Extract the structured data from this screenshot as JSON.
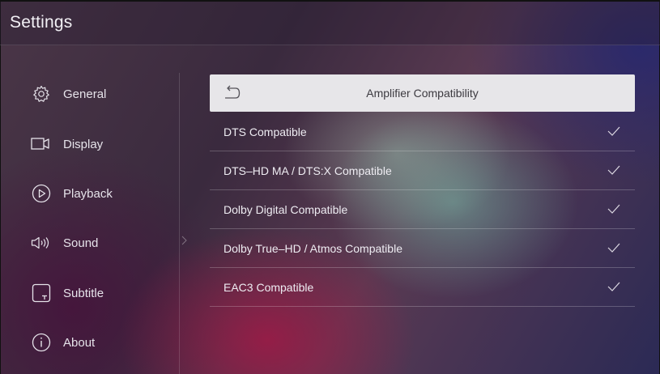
{
  "header": {
    "title": "Settings"
  },
  "sidebar": {
    "items": [
      {
        "label": "General",
        "icon": "gear-icon"
      },
      {
        "label": "Display",
        "icon": "display-icon"
      },
      {
        "label": "Playback",
        "icon": "play-icon"
      },
      {
        "label": "Sound",
        "icon": "speaker-icon"
      },
      {
        "label": "Subtitle",
        "icon": "subtitle-icon"
      },
      {
        "label": "About",
        "icon": "info-icon"
      }
    ],
    "selected": "Sound"
  },
  "panel": {
    "title": "Amplifier Compatibility",
    "back_icon": "back-arrow-icon",
    "options": [
      {
        "label": "DTS Compatible",
        "checked": true
      },
      {
        "label": "DTS–HD MA / DTS:X Compatible",
        "checked": true
      },
      {
        "label": "Dolby Digital Compatible",
        "checked": true
      },
      {
        "label": "Dolby True–HD / Atmos Compatible",
        "checked": true
      },
      {
        "label": "EAC3 Compatible",
        "checked": true
      }
    ]
  },
  "colors": {
    "header_bar": "#e7e6e9",
    "text": "#e8e6ee",
    "panel_title": "#3c3a40"
  }
}
